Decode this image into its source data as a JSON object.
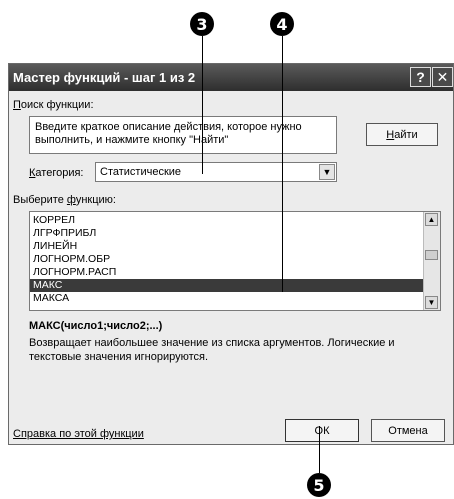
{
  "callouts": [
    "3",
    "4",
    "5"
  ],
  "dialog": {
    "title": "Мастер функций - шаг 1 из 2",
    "help_icon": "question-icon",
    "close_icon": "close-icon"
  },
  "search": {
    "label_key": "П",
    "label_rest": "оиск функции:",
    "input_value": "Введите краткое описание действия, которое нужно выполнить, и нажмите кнопку \"Найти\"",
    "find_button_key": "Н",
    "find_button_rest": "айти"
  },
  "category": {
    "label_key": "К",
    "label_rest": "атегория:",
    "selected": "Статистические"
  },
  "function_list": {
    "label_pre": "Выберите ",
    "label_key": "ф",
    "label_post": "ункцию:",
    "items": [
      "КОРРЕЛ",
      "ЛГРФПРИБЛ",
      "ЛИНЕЙН",
      "ЛОГНОРМ.ОБР",
      "ЛОГНОРМ.РАСП",
      "МАКС",
      "МАКСА"
    ],
    "selected_index": 5
  },
  "description": {
    "signature": "МАКС(число1;число2;...)",
    "text": "Возвращает наибольшее значение из списка аргументов. Логические и текстовые значения игнорируются."
  },
  "footer": {
    "help_link": "Справка по этой функции",
    "ok_label": "ОК",
    "cancel_label": "Отмена"
  }
}
